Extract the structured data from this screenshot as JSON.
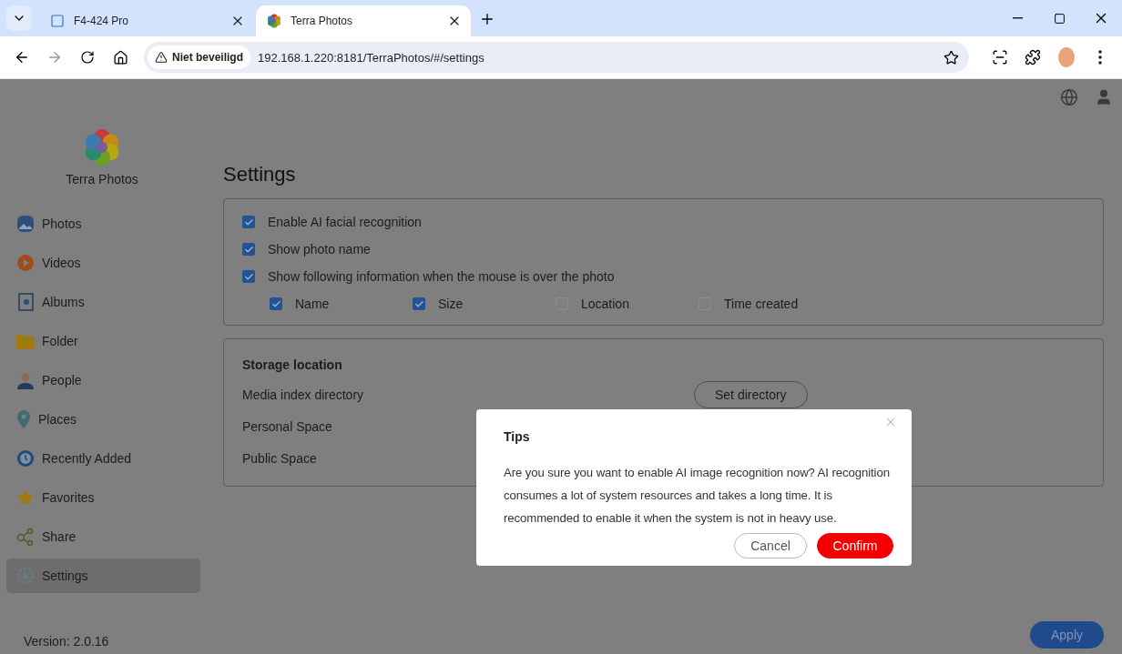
{
  "browser": {
    "tabs": [
      {
        "title": "F4-424 Pro",
        "selected": false
      },
      {
        "title": "Terra Photos",
        "selected": true
      }
    ],
    "security": "Niet beveiligd",
    "url": "192.168.1.220:8181/TerraPhotos/#/settings"
  },
  "app": {
    "name": "Terra Photos",
    "version": "Version: 2.0.16"
  },
  "sidebar": {
    "items": [
      {
        "label": "Photos",
        "selected": false
      },
      {
        "label": "Videos",
        "selected": false
      },
      {
        "label": "Albums",
        "selected": false
      },
      {
        "label": "Folder",
        "selected": false
      },
      {
        "label": "People",
        "selected": false
      },
      {
        "label": "Places",
        "selected": false
      },
      {
        "label": "Recently Added",
        "selected": false
      },
      {
        "label": "Favorites",
        "selected": false
      },
      {
        "label": "Share",
        "selected": false
      },
      {
        "label": "Settings",
        "selected": true
      }
    ]
  },
  "settings": {
    "title": "Settings",
    "options": [
      {
        "label": "Enable AI facial recognition",
        "checked": true
      },
      {
        "label": "Show photo name",
        "checked": true
      },
      {
        "label": "Show following information when the mouse is over the photo",
        "checked": true
      }
    ],
    "hover_fields": [
      {
        "label": "Name",
        "checked": true
      },
      {
        "label": "Size",
        "checked": true
      },
      {
        "label": "Location",
        "checked": false
      },
      {
        "label": "Time created",
        "checked": false
      }
    ],
    "storage": {
      "title": "Storage location",
      "rows": [
        {
          "label": "Media index directory",
          "button": "Set directory"
        },
        {
          "label": "Personal Space"
        },
        {
          "label": "Public Space"
        }
      ]
    },
    "apply": "Apply"
  },
  "dialog": {
    "title": "Tips",
    "message": "Are you sure you want to enable AI image recognition now? AI recognition consumes a lot of system resources and takes a long time. It is recommended to enable it when the system is not in heavy use.",
    "buttons": [
      {
        "label": "Cancel",
        "kind": "secondary"
      },
      {
        "label": "Confirm",
        "kind": "primary"
      }
    ]
  }
}
